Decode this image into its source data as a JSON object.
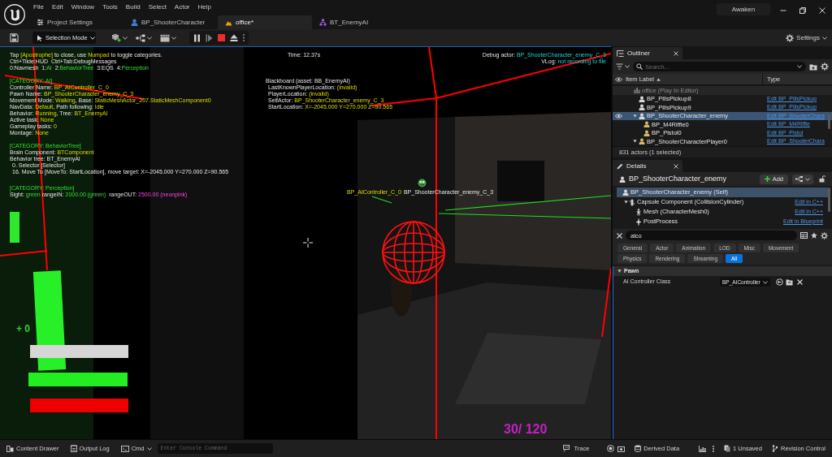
{
  "menu": [
    "File",
    "Edit",
    "Window",
    "Tools",
    "Build",
    "Select",
    "Actor",
    "Help"
  ],
  "tabs": [
    {
      "label": "Project Settings",
      "kind": "settings",
      "selected": false
    },
    {
      "label": "BP_ShooterCharacter",
      "kind": "blueprint",
      "selected": false
    },
    {
      "label": "office*",
      "kind": "level",
      "selected": true
    },
    {
      "label": "BT_EnemyAI",
      "kind": "tree",
      "selected": false
    }
  ],
  "project": "Awaken",
  "toolbar": {
    "mode": "Selection Mode",
    "settings": "Settings"
  },
  "viewport": {
    "left_blocks": [
      {
        "lines": [
          {
            "kind": "plain",
            "parts": [
              {
                "text": "Tap ",
                "kind": "text"
              },
              {
                "text": "[Apostrophe]",
                "kind": "value"
              },
              {
                "text": " to close, use ",
                "kind": "text"
              },
              {
                "text": "Numpad",
                "kind": "value"
              },
              {
                "text": " to toggle categories.",
                "kind": "text"
              }
            ]
          },
          {
            "kind": "plain",
            "parts": [
              {
                "text": "Ctrl+Tilde:HUD  Ctrl+Tab:DebugMessages",
                "kind": "text"
              }
            ]
          },
          {
            "kind": "plain",
            "parts": [
              {
                "text": "0:Navmesh  1:",
                "kind": "text"
              },
              {
                "text": "AI",
                "kind": "category"
              },
              {
                "text": "  2:",
                "kind": "text"
              },
              {
                "text": "BehaviorTree",
                "kind": "category"
              },
              {
                "text": "  3:EQS  4:",
                "kind": "text"
              },
              {
                "text": "Perception",
                "kind": "category"
              }
            ]
          }
        ]
      },
      {
        "lines": [
          {
            "kind": "plain",
            "parts": [
              {
                "text": "[CATEGORY: AI]",
                "kind": "category"
              }
            ]
          },
          {
            "kind": "plain",
            "parts": [
              {
                "text": "Controller Name: ",
                "kind": "text"
              },
              {
                "text": "BP_AIController_C_0",
                "kind": "value"
              }
            ]
          },
          {
            "kind": "plain",
            "parts": [
              {
                "text": "Pawn Name: ",
                "kind": "text"
              },
              {
                "text": "BP_ShooterCharacter_enemy_C_3",
                "kind": "value"
              }
            ]
          },
          {
            "kind": "plain",
            "parts": [
              {
                "text": "Movement Mode: ",
                "kind": "text"
              },
              {
                "text": "Walking",
                "kind": "value"
              },
              {
                "text": ", Base: ",
                "kind": "text"
              },
              {
                "text": "StaticMeshActor_207.StaticMeshComponent0",
                "kind": "value"
              }
            ]
          },
          {
            "kind": "plain",
            "parts": [
              {
                "text": "NavData: ",
                "kind": "text"
              },
              {
                "text": "Default",
                "kind": "value"
              },
              {
                "text": ", Path following: ",
                "kind": "text"
              },
              {
                "text": "Idle",
                "kind": "value"
              }
            ]
          },
          {
            "kind": "plain",
            "parts": [
              {
                "text": "Behavior: ",
                "kind": "text"
              },
              {
                "text": "Running",
                "kind": "value"
              },
              {
                "text": ", Tree: ",
                "kind": "text"
              },
              {
                "text": "BT_EnemyAI",
                "kind": "value"
              }
            ]
          },
          {
            "kind": "plain",
            "parts": [
              {
                "text": "Active task: ",
                "kind": "text"
              },
              {
                "text": "None",
                "kind": "value"
              }
            ]
          },
          {
            "kind": "plain",
            "parts": [
              {
                "text": "Gameplay tasks: ",
                "kind": "text"
              },
              {
                "text": "0",
                "kind": "value"
              }
            ]
          },
          {
            "kind": "plain",
            "parts": [
              {
                "text": "Montage: ",
                "kind": "text"
              },
              {
                "text": "None",
                "kind": "value"
              }
            ]
          }
        ]
      },
      {
        "lines": [
          {
            "kind": "plain",
            "parts": [
              {
                "text": "[CATEGORY: BehaviorTree]",
                "kind": "category"
              }
            ]
          },
          {
            "kind": "plain",
            "parts": [
              {
                "text": "Brain Component: ",
                "kind": "text"
              },
              {
                "text": "BTComponent",
                "kind": "value"
              }
            ]
          },
          {
            "kind": "plain",
            "parts": [
              {
                "text": "Behavior tree: BT_EnemyAI",
                "kind": "text"
              }
            ]
          },
          {
            "kind": "node",
            "parts": [
              {
                "text": "0. Selector [Selector]",
                "kind": "text"
              }
            ]
          },
          {
            "kind": "node",
            "parts": [
              {
                "text": "16. Move To [MoveTo: StartLocation], move target: X=-2045.000 Y=270.000 Z=90.565",
                "kind": "text"
              }
            ]
          }
        ]
      },
      {
        "lines": [
          {
            "kind": "plain",
            "parts": [
              {
                "text": "[CATEGORY: Perception]",
                "kind": "category"
              }
            ]
          },
          {
            "kind": "plain",
            "parts": [
              {
                "text": "Sight: ",
                "kind": "text"
              },
              {
                "text": "green",
                "kind": "category"
              },
              {
                "text": " rangeIN: ",
                "kind": "text"
              },
              {
                "text": "2000.00 (green)",
                "kind": "category"
              },
              {
                "text": "  rangeOUT: ",
                "kind": "text"
              },
              {
                "text": "2500.00 (neonpink)",
                "kind": "pink"
              }
            ]
          }
        ]
      }
    ],
    "time": "Time: 12.37s",
    "right_lines": [
      {
        "parts": [
          {
            "text": "Debug actor: ",
            "kind": "text"
          },
          {
            "text": "BP_ShooterCharacter_enemy_C_3",
            "kind": "info"
          }
        ]
      },
      {
        "parts": [
          {
            "text": "VLog: ",
            "kind": "text"
          },
          {
            "text": "not recording to file",
            "kind": "info"
          }
        ]
      }
    ],
    "blackboard": [
      {
        "kind": "plain",
        "parts": [
          {
            "text": "Blackboard (asset: BB_EnemyAI)",
            "kind": "text"
          }
        ]
      },
      {
        "kind": "node",
        "parts": [
          {
            "text": "LastKnownPlayerLocation: ",
            "kind": "text"
          },
          {
            "text": "(invalid)",
            "kind": "value"
          }
        ]
      },
      {
        "kind": "node",
        "parts": [
          {
            "text": "PlayerLocation: ",
            "kind": "text"
          },
          {
            "text": "(invalid)",
            "kind": "value"
          }
        ]
      },
      {
        "kind": "node",
        "parts": [
          {
            "text": "SelfActor: ",
            "kind": "text"
          },
          {
            "text": "BP_ShooterCharacter_enemy_C_3",
            "kind": "value"
          }
        ]
      },
      {
        "kind": "node",
        "parts": [
          {
            "text": "StartLocation: ",
            "kind": "text"
          },
          {
            "text": "X=-2045.000 Y=270.000 Z=90.565",
            "kind": "value"
          }
        ]
      }
    ],
    "world_labels": [
      {
        "text": "BP_AIController_C_0",
        "kind": "value"
      },
      {
        "text": "BP_ShooterCharacter_enemy_C_3",
        "kind": "text"
      }
    ],
    "hud": {
      "counter": "+ 0",
      "ammo": "30/ 120"
    }
  },
  "outliner": {
    "title": "Outliner",
    "search": {
      "placeholder": "Search..."
    },
    "columns": [
      "Item Label",
      "Type"
    ],
    "rows": [
      {
        "label": "office (Play In Editor)",
        "kind": "world",
        "selected": false,
        "children": [
          {
            "label": "BP_PillsPickup8",
            "kind": "actor",
            "type": "Edit BP_PillsPickup",
            "selected": false
          },
          {
            "label": "BP_PillsPickup9",
            "kind": "actor",
            "type": "Edit BP_PillsPickup",
            "selected": false
          },
          {
            "label": "BP_ShooterCharacter_enemy",
            "kind": "actor",
            "type": "Edit BP_ShooterChara",
            "selected": true,
            "expanded": true,
            "children": [
              {
                "label": "BP_M4Riffle0",
                "kind": "weapon",
                "type": "Edit BP_M4Riffle",
                "selected": false
              },
              {
                "label": "BP_Pistol0",
                "kind": "weapon",
                "type": "Edit BP_Pistol",
                "selected": false
              }
            ]
          },
          {
            "label": "BP_ShooterCharacterPlayer0",
            "kind": "weapon",
            "type": "Edit BP_ShooterChara",
            "selected": false,
            "expanded": true
          }
        ]
      }
    ],
    "footer": "831 actors (1 selected)"
  },
  "details": {
    "title": "Details",
    "actor": "BP_ShooterCharacter_enemy",
    "add_button": "Add",
    "components": [
      {
        "label": "BP_ShooterCharacter_enemy (Self)",
        "kind": "self",
        "selected": true,
        "children": [
          {
            "label": "Capsule Component (CollisionCylinder)",
            "kind": "capsule",
            "action": "Edit in C++",
            "selected": false,
            "expanded": true,
            "children": [
              {
                "label": "Mesh (CharacterMesh0)",
                "kind": "mesh",
                "action": "Edit in C++",
                "selected": false
              },
              {
                "label": "PostProcess",
                "kind": "postprocess",
                "action": "Edit in Blueprint",
                "selected": false
              }
            ]
          }
        ]
      }
    ],
    "search": {
      "value": "aico"
    },
    "filters": [
      {
        "label": "General",
        "selected": false
      },
      {
        "label": "Actor",
        "selected": false
      },
      {
        "label": "Animation",
        "selected": false
      },
      {
        "label": "LOD",
        "selected": false
      },
      {
        "label": "Misc",
        "selected": false
      },
      {
        "label": "Movement",
        "selected": false
      },
      {
        "label": "Physics",
        "selected": false
      },
      {
        "label": "Rendering",
        "selected": false
      },
      {
        "label": "Streaming",
        "selected": false
      },
      {
        "label": "All",
        "selected": true
      }
    ],
    "sections": [
      {
        "title": "Pawn",
        "expanded": true,
        "properties": [
          {
            "label": "AI Controller Class",
            "value": "BP_AIController"
          }
        ]
      }
    ]
  },
  "status_bar": {
    "left": [
      {
        "kind": "drawer",
        "label": "Content Drawer"
      },
      {
        "kind": "log",
        "label": "Output Log"
      },
      {
        "kind": "cmd",
        "label": "Cmd"
      }
    ],
    "console": {
      "placeholder": "Enter Console Command"
    },
    "right": [
      {
        "kind": "trace",
        "label": "Trace"
      },
      {
        "kind": "data",
        "label": "Derived Data"
      },
      {
        "kind": "unsaved",
        "label": "1 Unsaved"
      },
      {
        "kind": "revision",
        "label": "Revision Control"
      }
    ]
  }
}
